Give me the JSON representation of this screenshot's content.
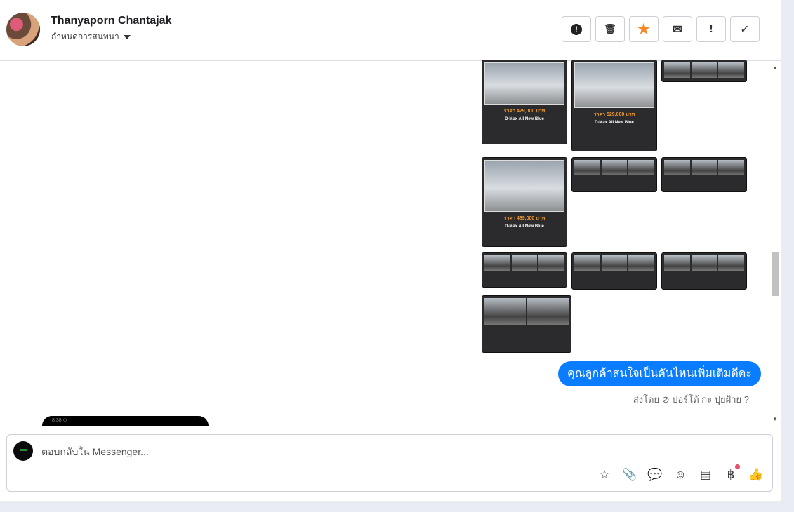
{
  "header": {
    "name": "Thanyaporn Chantajak",
    "subtitle": "กำหนดการสนทนา"
  },
  "toolbar": [
    {
      "icon": "alert-circle-icon",
      "glyph": "⬤"
    },
    {
      "icon": "trash-icon",
      "glyph": "🗑"
    },
    {
      "icon": "star-icon",
      "glyph": "★"
    },
    {
      "icon": "mail-icon",
      "glyph": "✉"
    },
    {
      "icon": "exclamation-icon",
      "glyph": "!"
    },
    {
      "icon": "check-icon",
      "glyph": "✓"
    }
  ],
  "cards": {
    "a_price": "ราคา 429,000 บาท",
    "b_price": "ราคา 529,000 บาท",
    "d_price": "ราคา 469,000 บาท",
    "model": "D-Max All New Blue"
  },
  "message": {
    "text": "คุณลูกค้าสนใจเป็นคันไหนเพิ่มเติมดีคะ",
    "sent_by": "ส่งโดย ⊘ ปอร์โต้ กะ ปุยฝ้าย ?"
  },
  "phone_status": "8:38 ⊙",
  "composer": {
    "placeholder": "ตอบกลับใน Messenger..."
  },
  "composer_icons": [
    {
      "icon": "saved-reply-icon",
      "glyph": "☆"
    },
    {
      "icon": "attachment-icon",
      "glyph": "📎"
    },
    {
      "icon": "chat-icon",
      "glyph": "💬"
    },
    {
      "icon": "emoji-icon",
      "glyph": "☺"
    },
    {
      "icon": "catalog-icon",
      "glyph": "▤"
    },
    {
      "icon": "baht-icon",
      "glyph": "฿"
    },
    {
      "icon": "like-icon",
      "glyph": "👍"
    }
  ],
  "colors": {
    "accent": "#0a7cff",
    "star": "#f5892a"
  }
}
